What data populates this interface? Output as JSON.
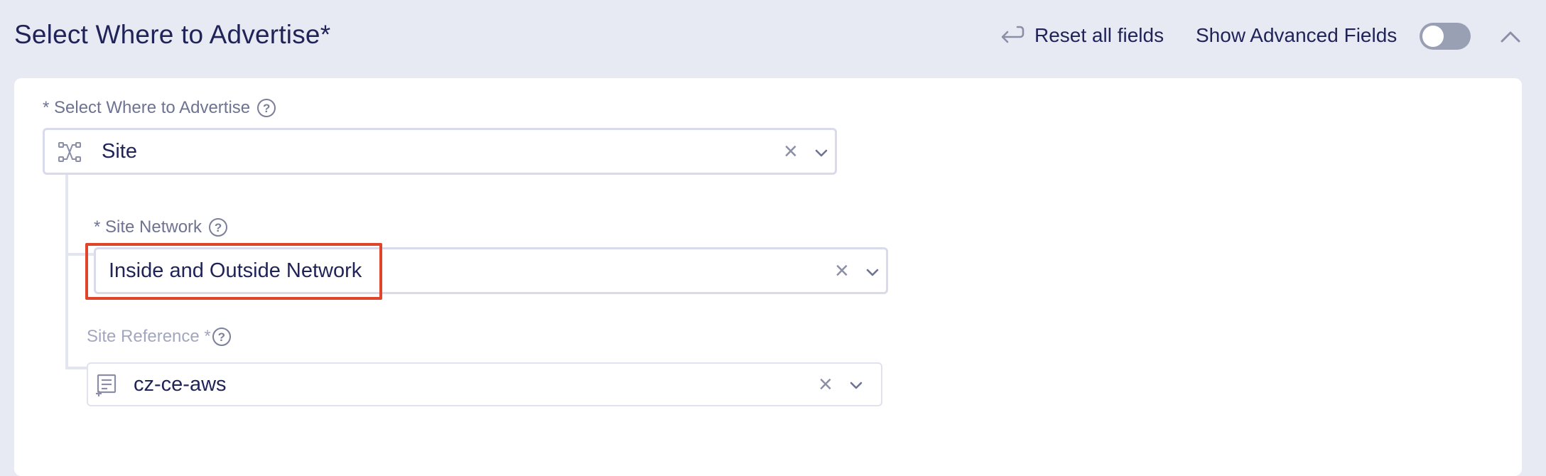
{
  "header": {
    "title": "Select Where to Advertise",
    "title_required_mark": "*",
    "reset_label": "Reset all fields",
    "advanced_label": "Show Advanced Fields",
    "advanced_toggle_on": false
  },
  "where_field": {
    "label": "* Select Where to Advertise",
    "value": "Site",
    "icon": "network-topology-icon"
  },
  "site_network_field": {
    "label": "* Site Network",
    "value": "Inside and Outside Network"
  },
  "site_reference_field": {
    "label": "Site Reference *",
    "value": "cz-ce-aws",
    "icon": "reference-list-icon"
  },
  "icons": {
    "help": "?",
    "clear": "×"
  },
  "colors": {
    "page_bg": "#e8eaf3",
    "text_primary": "#1f2357",
    "highlight": "#e0452b",
    "toggle_off": "#9aa0b4"
  }
}
